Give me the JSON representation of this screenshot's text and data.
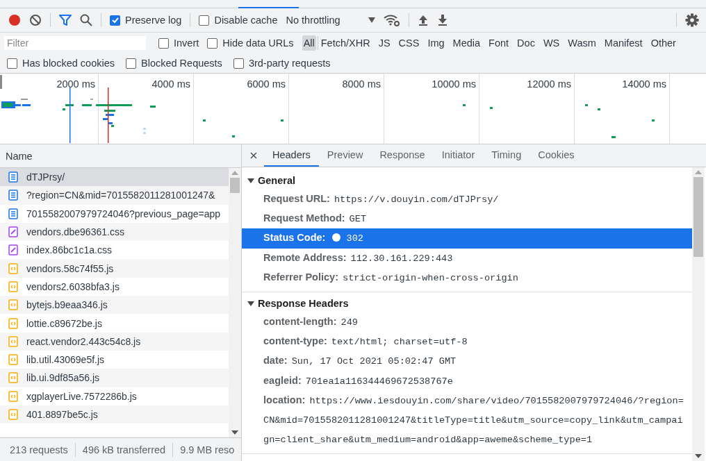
{
  "toolbar": {
    "recording": true,
    "filter_active": true,
    "throttling": "No throttling",
    "checks": [
      {
        "label": "Preserve log",
        "checked": true
      },
      {
        "label": "Disable cache",
        "checked": false
      }
    ]
  },
  "filter_bar": {
    "placeholder": "Filter",
    "checks": [
      {
        "label": "Invert",
        "checked": false
      },
      {
        "label": "Hide data URLs",
        "checked": false
      }
    ],
    "types": [
      {
        "label": "All",
        "selected": true
      },
      {
        "label": "Fetch/XHR",
        "selected": false
      },
      {
        "label": "JS",
        "selected": false
      },
      {
        "label": "CSS",
        "selected": false
      },
      {
        "label": "Img",
        "selected": false
      },
      {
        "label": "Media",
        "selected": false
      },
      {
        "label": "Font",
        "selected": false
      },
      {
        "label": "Doc",
        "selected": false
      },
      {
        "label": "WS",
        "selected": false
      },
      {
        "label": "Wasm",
        "selected": false
      },
      {
        "label": "Manifest",
        "selected": false
      },
      {
        "label": "Other",
        "selected": false
      }
    ]
  },
  "options": [
    {
      "label": "Has blocked cookies",
      "checked": false
    },
    {
      "label": "Blocked Requests",
      "checked": false
    },
    {
      "label": "3rd-party requests",
      "checked": false
    }
  ],
  "overview": {
    "ticks": [
      "2000 ms",
      "4000 ms",
      "6000 ms",
      "8000 ms",
      "10000 ms",
      "12000 ms",
      "14000 ms"
    ]
  },
  "requests": {
    "column": "Name",
    "rows": [
      {
        "name": "dTJPrsy/",
        "kind": "doc",
        "selected": true
      },
      {
        "name": "?region=CN&mid=7015582011281001247&",
        "kind": "doc",
        "selected": false
      },
      {
        "name": "7015582007979724046?previous_page=app",
        "kind": "doc",
        "selected": false
      },
      {
        "name": "vendors.dbe96361.css",
        "kind": "css",
        "selected": false
      },
      {
        "name": "index.86bc1c1a.css",
        "kind": "css",
        "selected": false
      },
      {
        "name": "vendors.58c74f55.js",
        "kind": "js",
        "selected": false
      },
      {
        "name": "vendors2.6038bfa3.js",
        "kind": "js",
        "selected": false
      },
      {
        "name": "bytejs.b9eaa346.js",
        "kind": "js",
        "selected": false
      },
      {
        "name": "lottie.c89672be.js",
        "kind": "js",
        "selected": false
      },
      {
        "name": "react.vendor2.443c54c8.js",
        "kind": "js",
        "selected": false
      },
      {
        "name": "lib.util.43069e5f.js",
        "kind": "js",
        "selected": false
      },
      {
        "name": "lib.ui.9df85a56.js",
        "kind": "js",
        "selected": false
      },
      {
        "name": "xgplayerLive.7572286b.js",
        "kind": "js",
        "selected": false
      },
      {
        "name": "401.8897be5c.js",
        "kind": "js",
        "selected": false
      }
    ]
  },
  "status_bar": [
    "213 requests",
    "496 kB transferred",
    "9.9 MB reso"
  ],
  "details": {
    "tabs": [
      {
        "label": "Headers",
        "selected": true
      },
      {
        "label": "Preview",
        "selected": false
      },
      {
        "label": "Response",
        "selected": false
      },
      {
        "label": "Initiator",
        "selected": false
      },
      {
        "label": "Timing",
        "selected": false
      },
      {
        "label": "Cookies",
        "selected": false
      }
    ],
    "sections": [
      {
        "title": "General",
        "expanded": true,
        "rows": [
          {
            "kind": "field",
            "key": "Request URL:",
            "value": "https://v.douyin.com/dTJPrsy/",
            "selected": false
          },
          {
            "kind": "field",
            "key": "Request Method:",
            "value": "GET",
            "selected": false
          },
          {
            "kind": "status",
            "key": "Status Code:",
            "value": "302",
            "selected": true
          },
          {
            "kind": "field",
            "key": "Remote Address:",
            "value": "112.30.161.229:443",
            "selected": false
          },
          {
            "kind": "field",
            "key": "Referrer Policy:",
            "value": "strict-origin-when-cross-origin",
            "selected": false
          }
        ]
      },
      {
        "title": "Response Headers",
        "expanded": true,
        "rows": [
          {
            "kind": "field",
            "key": "content-length:",
            "value": "249",
            "selected": false
          },
          {
            "kind": "field",
            "key": "content-type:",
            "value": "text/html; charset=utf-8",
            "selected": false
          },
          {
            "kind": "field",
            "key": "date:",
            "value": "Sun, 17 Oct 2021 05:02:47 GMT",
            "selected": false
          },
          {
            "kind": "field",
            "key": "eagleid:",
            "value": "701ea1a116344469672538767e",
            "selected": false
          },
          {
            "kind": "field",
            "key": "location:",
            "value": "https://www.iesdouyin.com/share/video/7015582007979724046/?region=CN&mid=7015582011281001247&titleType=title&utm_source=copy_link&utm_campaign=client_share&utm_medium=android&app=aweme&scheme_type=1",
            "selected": false
          }
        ]
      }
    ]
  }
}
